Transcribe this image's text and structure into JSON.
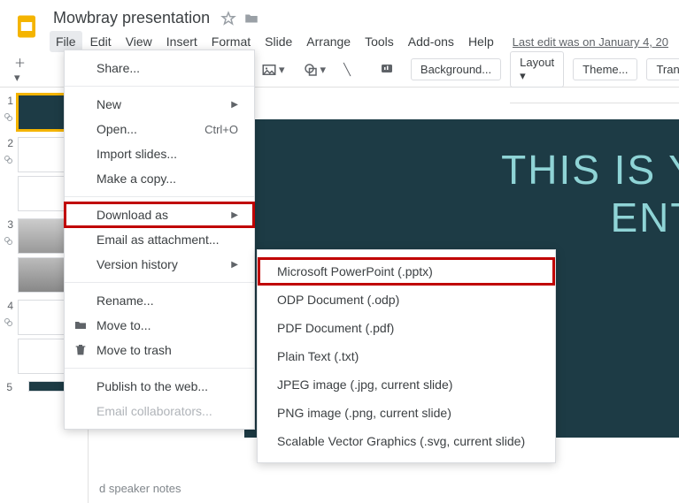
{
  "doc": {
    "title": "Mowbray presentation"
  },
  "menus": {
    "file": "File",
    "edit": "Edit",
    "view": "View",
    "insert": "Insert",
    "format": "Format",
    "slide": "Slide",
    "arrange": "Arrange",
    "tools": "Tools",
    "addons": "Add-ons",
    "help": "Help"
  },
  "last_edit": "Last edit was on January 4, 20",
  "toolbar": {
    "background": "Background...",
    "layout": "Layout",
    "theme": "Theme...",
    "transition": "Transition..."
  },
  "thumbs": {
    "n1": "1",
    "n2": "2",
    "n3": "3",
    "n4": "4",
    "n5": "5"
  },
  "file_menu": {
    "share": "Share...",
    "new": "New",
    "open": "Open...",
    "open_shortcut": "Ctrl+O",
    "import": "Import slides...",
    "copy": "Make a copy...",
    "download": "Download as",
    "email_attach": "Email as attachment...",
    "version": "Version history",
    "rename": "Rename...",
    "move": "Move to...",
    "trash": "Move to trash",
    "publish": "Publish to the web...",
    "email_collab": "Email collaborators..."
  },
  "download_submenu": {
    "pptx": "Microsoft PowerPoint (.pptx)",
    "odp": "ODP Document (.odp)",
    "pdf": "PDF Document (.pdf)",
    "txt": "Plain Text (.txt)",
    "jpg": "JPEG image (.jpg, current slide)",
    "png": "PNG image (.png, current slide)",
    "svg": "Scalable Vector Graphics (.svg, current slide)"
  },
  "slide": {
    "line1": "THIS IS YOUR",
    "line2": "ENTATIO"
  },
  "notes": {
    "placeholder": "d speaker notes"
  }
}
